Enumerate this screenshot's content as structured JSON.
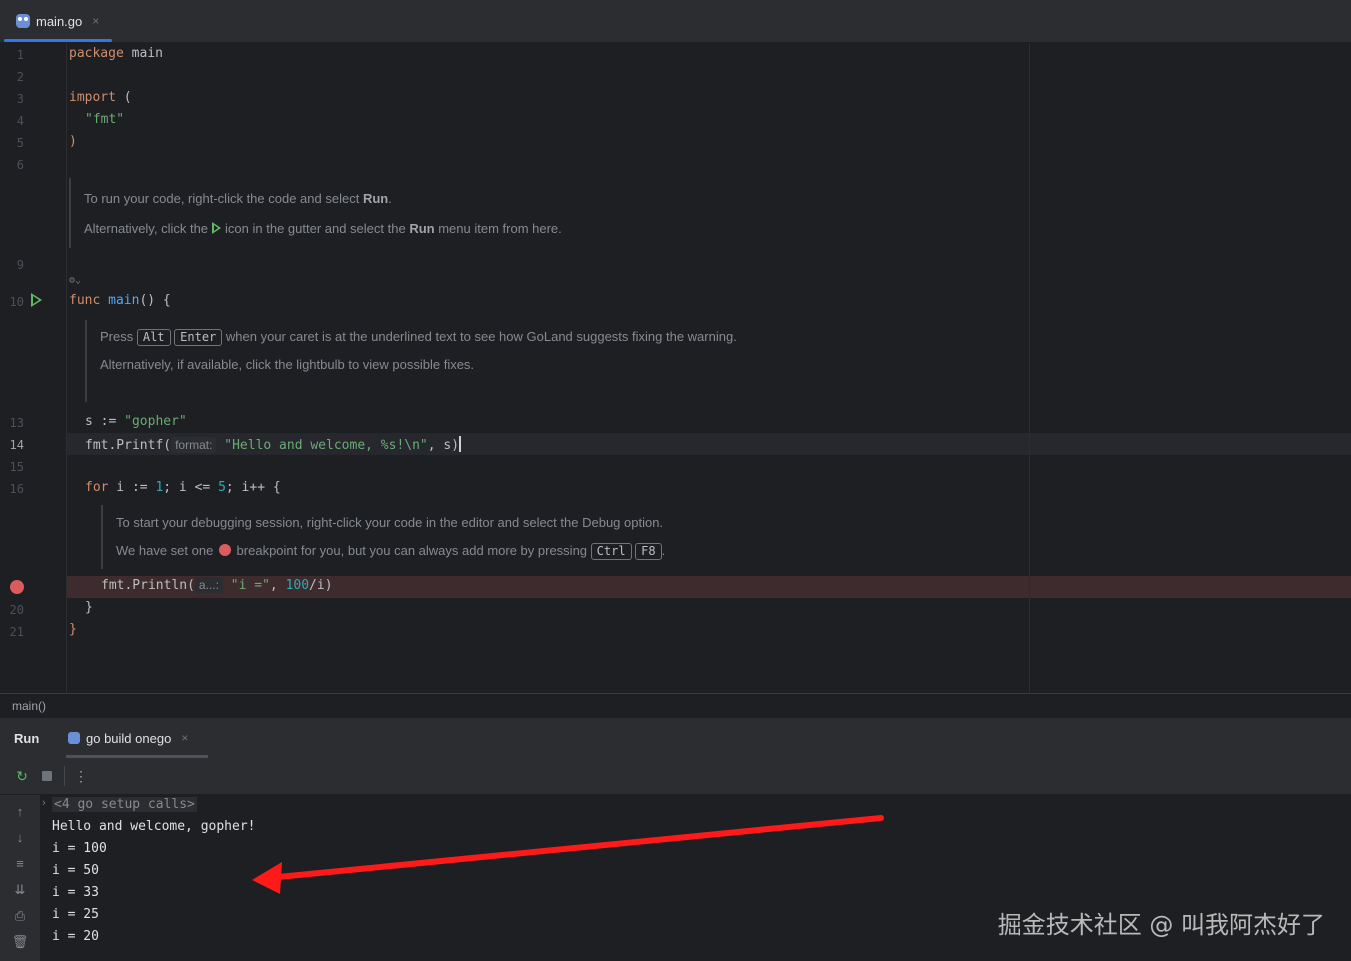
{
  "editor_tabs": [
    {
      "label": "main.go",
      "close": "×"
    }
  ],
  "line_numbers": {
    "l1": "1",
    "l2": "2",
    "l3": "3",
    "l4": "4",
    "l5": "5",
    "l6": "6",
    "l9": "9",
    "l10": "10",
    "l13": "13",
    "l14": "14",
    "l15": "15",
    "l16": "16",
    "l20": "20",
    "l21": "21"
  },
  "code": {
    "l1_kw": "package",
    "l1_rest": " main",
    "l3_kw": "import",
    "l3_rest": " (",
    "l4_str": "\"fmt\"",
    "l5": ")",
    "l10_kw": "func",
    "l10_fn": "main",
    "l10_rest": "() {",
    "l13_a": "s := ",
    "l13_str": "\"gopher\"",
    "l14_a": "fmt.Printf(",
    "l14_hint": "format:",
    "l14_str": "\"Hello and welcome, %s!\\n\"",
    "l14_b": ", s)",
    "l16_kw": "for",
    "l16_a": " i := ",
    "l16_n1": "1",
    "l16_b": "; i <= ",
    "l16_n2": "5",
    "l16_c": "; i++ {",
    "l19_a": "fmt.Println(",
    "l19_hint": "a...:",
    "l19_str": "\"i =\"",
    "l19_b": ", ",
    "l19_num": "100",
    "l19_c": "/i)",
    "l20": "}",
    "l21": "}"
  },
  "docs": {
    "d1_p1_a": "To run your code, right-click the code and select ",
    "d1_p1_b": "Run",
    "d1_p1_c": ".",
    "d1_p2_a": "Alternatively, click the",
    "d1_p2_b": "icon in the gutter and select the ",
    "d1_p2_c": "Run",
    "d1_p2_d": " menu item from here.",
    "d2_p1_a": "Press ",
    "d2_key1": "Alt",
    "d2_key2": "Enter",
    "d2_p1_b": " when your caret is at the underlined text to see how GoLand suggests fixing the warning.",
    "d2_p2": "Alternatively, if available, click the lightbulb to view possible fixes.",
    "d3_p1": "To start your debugging session, right-click your code in the editor and select the Debug option.",
    "d3_p2_a": "We have set one ",
    "d3_p2_b": " breakpoint for you, but you can always add more by pressing ",
    "d3_key1": "Ctrl",
    "d3_key2": "F8",
    "d3_p2_c": "."
  },
  "breadcrumb": "main()",
  "run_panel": {
    "title": "Run",
    "tab_label": "go build onego",
    "tab_close": "×",
    "toolbar": {
      "rerun": "↻",
      "more": "⋮"
    }
  },
  "console": {
    "setup": "<4 go setup calls>",
    "lines": [
      "Hello and welcome, gopher!",
      "i = 100",
      "i = 50",
      "i = 33",
      "i = 25",
      "i = 20"
    ]
  },
  "watermark": "掘金技术社区 @ 叫我阿杰好了",
  "colors": {
    "accent": "#3574f0",
    "breakpoint": "#db5c5c",
    "run_green": "#5fb865",
    "arrow": "#ff1a1a"
  }
}
